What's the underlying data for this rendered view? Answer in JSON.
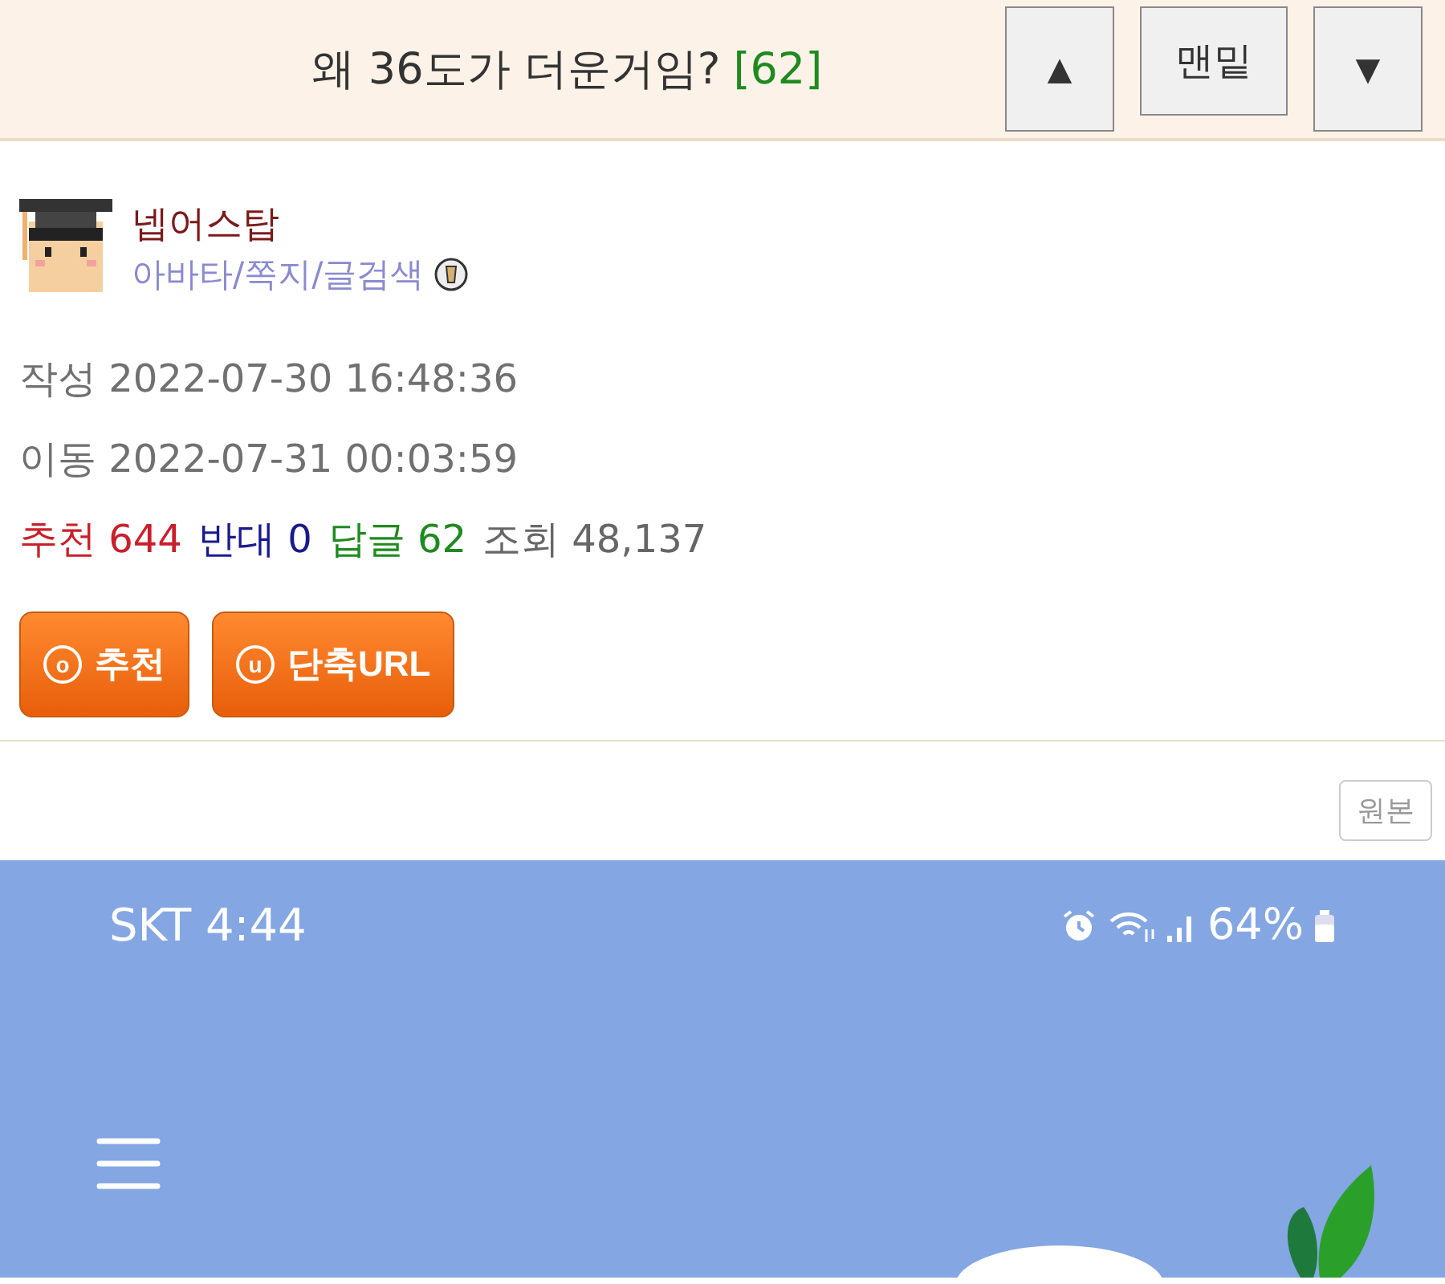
{
  "header": {
    "title": "왜 36도가 더운거임?",
    "reply_count": "[62]",
    "buttons": [
      {
        "kind": "up",
        "label": "▲"
      },
      {
        "kind": "bottom",
        "label": "맨밑"
      },
      {
        "kind": "down",
        "label": "▼"
      }
    ]
  },
  "author": {
    "name": "넵어스탑",
    "links": "아바타/쪽지/글검색"
  },
  "meta": [
    {
      "label": "작성",
      "value": "2022-07-30 16:48:36"
    },
    {
      "label": "이동",
      "value": "2022-07-31 00:03:59"
    }
  ],
  "stats": [
    {
      "label": "추천",
      "value": "644",
      "color": "#c8202a"
    },
    {
      "label": "반대",
      "value": "0",
      "color": "#1a1a8c"
    },
    {
      "label": "답글",
      "value": "62",
      "color": "#1f8a1f"
    },
    {
      "label": "조회",
      "value": "48,137",
      "color": "#666666"
    }
  ],
  "actions": [
    {
      "mark": "o",
      "label": "추천"
    },
    {
      "mark": "u",
      "label": "단축URL"
    }
  ],
  "original_button": "원본",
  "embedded_screenshot": {
    "status_left": "SKT 4:44",
    "battery": "64%"
  }
}
